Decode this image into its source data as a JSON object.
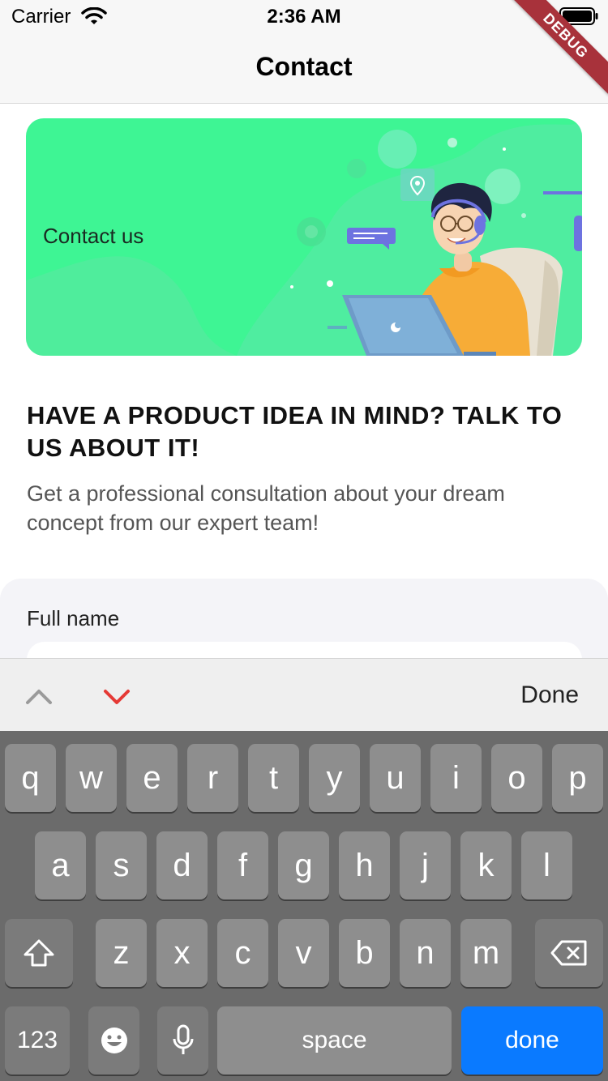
{
  "status_bar": {
    "carrier": "Carrier",
    "time": "2:36 AM"
  },
  "debug_banner": {
    "label": "DEBUG"
  },
  "nav": {
    "title": "Contact"
  },
  "banner": {
    "text": "Contact us"
  },
  "content": {
    "headline": "HAVE A PRODUCT IDEA IN MIND? TALK TO US ABOUT IT!",
    "subtext": "Get a professional consultation about your dream concept from our expert team!"
  },
  "form": {
    "full_name_label": "Full name",
    "full_name_value": ""
  },
  "keyboard_toolbar": {
    "done_label": "Done",
    "prev_icon": "chevron-up-icon",
    "next_icon": "chevron-down-icon"
  },
  "keyboard": {
    "row1": [
      "q",
      "w",
      "e",
      "r",
      "t",
      "y",
      "u",
      "i",
      "o",
      "p"
    ],
    "row2": [
      "a",
      "s",
      "d",
      "f",
      "g",
      "h",
      "j",
      "k",
      "l"
    ],
    "row3": [
      "z",
      "x",
      "c",
      "v",
      "b",
      "n",
      "m"
    ],
    "numbers_label": "123",
    "space_label": "space",
    "return_label": "done",
    "shift_icon": "shift-icon",
    "delete_icon": "delete-icon",
    "emoji_icon": "emoji-icon",
    "mic_icon": "microphone-icon"
  },
  "colors": {
    "banner_green": "#3ef594",
    "accent_blue": "#0a7aff",
    "next_arrow_red": "#e53935"
  }
}
